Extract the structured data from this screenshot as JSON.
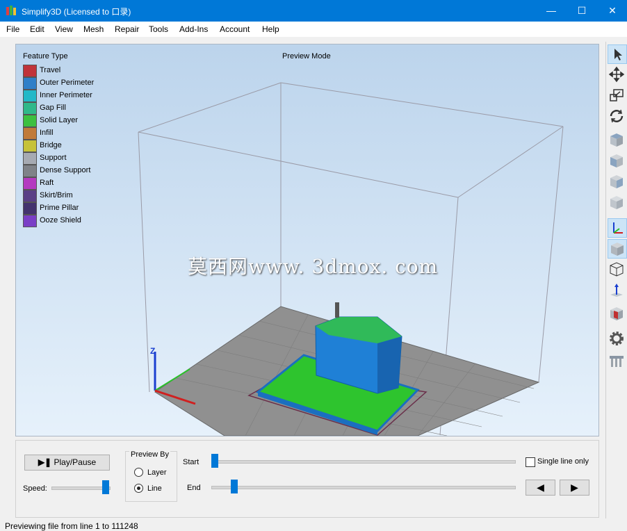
{
  "window": {
    "title": "Simplify3D (Licensed to 口录)"
  },
  "window_controls": {
    "minimize": "—",
    "maximize": "☐",
    "close": "✕"
  },
  "menu": [
    "File",
    "Edit",
    "View",
    "Mesh",
    "Repair",
    "Tools",
    "Add-Ins",
    "Account",
    "Help"
  ],
  "viewport": {
    "legend_title": "Feature Type",
    "mode_label": "Preview Mode",
    "watermark": "莫西网www. 3dmox. com",
    "legend": [
      {
        "label": "Travel",
        "color": "#c0333a"
      },
      {
        "label": "Outer Perimeter",
        "color": "#2f7fc8"
      },
      {
        "label": "Inner Perimeter",
        "color": "#22b8c8"
      },
      {
        "label": "Gap Fill",
        "color": "#2fb88a"
      },
      {
        "label": "Solid Layer",
        "color": "#3cc040"
      },
      {
        "label": "Infill",
        "color": "#c07a3a"
      },
      {
        "label": "Bridge",
        "color": "#c6c23a"
      },
      {
        "label": "Support",
        "color": "#a6aab2"
      },
      {
        "label": "Dense Support",
        "color": "#7f8288"
      },
      {
        "label": "Raft",
        "color": "#b43ac0"
      },
      {
        "label": "Skirt/Brim",
        "color": "#5a3f86"
      },
      {
        "label": "Prime Pillar",
        "color": "#43336e"
      },
      {
        "label": "Ooze Shield",
        "color": "#7a3fc6"
      }
    ]
  },
  "toolbar": {
    "tools": [
      {
        "icon": "select-arrow-icon",
        "selected": true
      },
      {
        "icon": "move-icon",
        "selected": false
      },
      {
        "icon": "scale-icon",
        "selected": false
      },
      {
        "icon": "rotate-icon",
        "selected": false
      },
      {
        "icon": "view-top-icon",
        "selected": false
      },
      {
        "icon": "view-front-icon",
        "selected": false
      },
      {
        "icon": "view-side-icon",
        "selected": false
      },
      {
        "icon": "view-iso-icon",
        "selected": false
      },
      {
        "icon": "axes-toggle-icon",
        "selected": true
      },
      {
        "icon": "solid-view-icon",
        "selected": true
      },
      {
        "icon": "wireframe-view-icon",
        "selected": false
      },
      {
        "icon": "normals-icon",
        "selected": false
      },
      {
        "icon": "cross-section-icon",
        "selected": false
      },
      {
        "icon": "settings-gear-icon",
        "selected": false
      },
      {
        "icon": "support-structures-icon",
        "selected": false
      }
    ]
  },
  "controls": {
    "play_pause": "Play/Pause",
    "speed_label": "Speed:",
    "speed_value": 1.0,
    "preview_by_title": "Preview By",
    "layer_label": "Layer",
    "line_label": "Line",
    "preview_by_selected": "Line",
    "start_label": "Start",
    "start_value": 0.0,
    "end_label": "End",
    "end_value": 0.04,
    "single_line_label": "Single line only",
    "single_line_checked": false,
    "prev_icon": "◀",
    "next_icon": "▶"
  },
  "status": "Previewing file from line 1 to 111248"
}
